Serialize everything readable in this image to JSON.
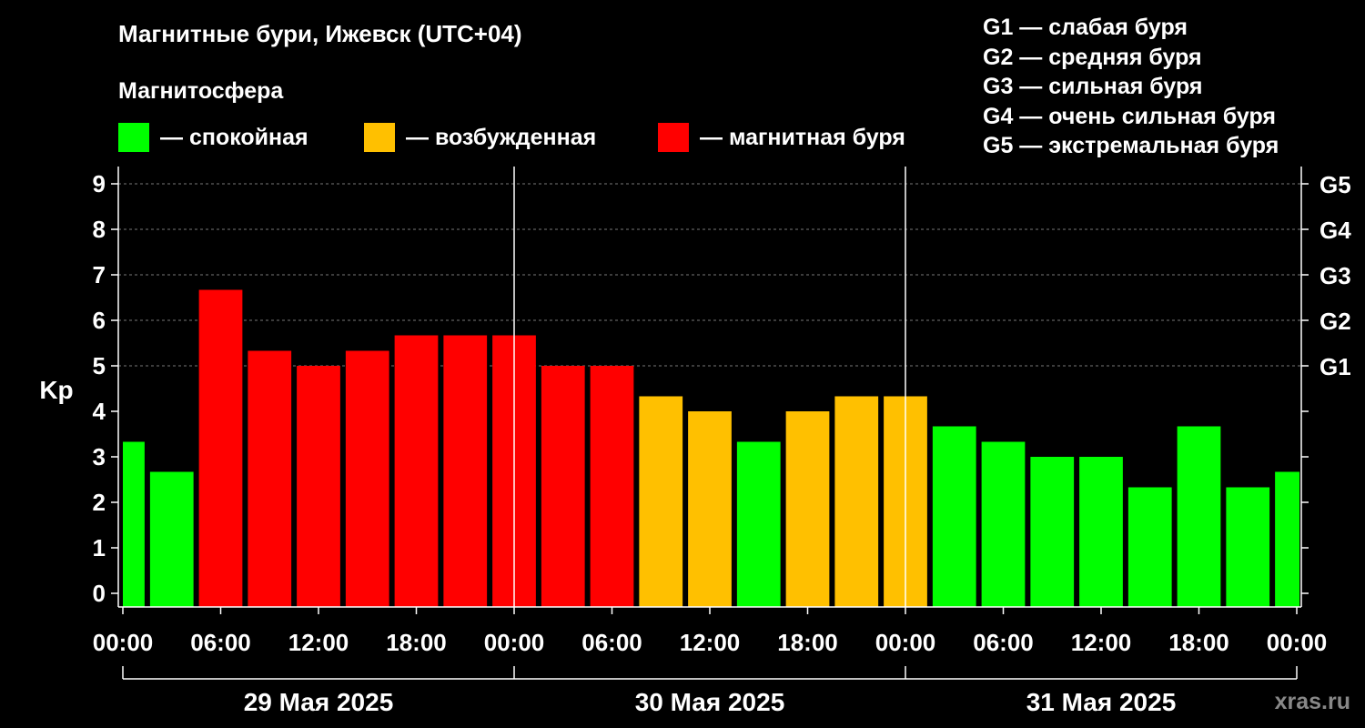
{
  "title": "Магнитные бури, Ижевск (UTC+04)",
  "subtitle": "Магнитосфера",
  "legend": [
    {
      "label": "— спокойная",
      "color": "#00ff00"
    },
    {
      "label": "— возбужденная",
      "color": "#ffc000"
    },
    {
      "label": "— магнитная буря",
      "color": "#ff0000"
    }
  ],
  "g_legend": [
    "G1 — слабая буря",
    "G2 — средняя буря",
    "G3 — сильная буря",
    "G4 — очень сильная буря",
    "G5 — экстремальная буря"
  ],
  "watermark": "xras.ru",
  "chart_data": {
    "type": "bar",
    "ylabel": "Kp",
    "ylim": [
      0,
      9
    ],
    "yticks": [
      "0",
      "1",
      "2",
      "3",
      "4",
      "5",
      "6",
      "7",
      "8",
      "9"
    ],
    "right_ticks": [
      {
        "value": 5,
        "label": "G1"
      },
      {
        "value": 6,
        "label": "G2"
      },
      {
        "value": 7,
        "label": "G3"
      },
      {
        "value": 8,
        "label": "G4"
      },
      {
        "value": 9,
        "label": "G5"
      }
    ],
    "xticks": [
      "00:00",
      "06:00",
      "12:00",
      "18:00",
      "00:00",
      "06:00",
      "12:00",
      "18:00",
      "00:00",
      "06:00",
      "12:00",
      "18:00",
      "00:00"
    ],
    "days": [
      "29 Мая 2025",
      "30 Мая 2025",
      "31 Мая 2025"
    ],
    "grid": "horizontal dashed at 5–9",
    "values": [
      3.33,
      2.67,
      6.67,
      5.33,
      5.0,
      5.33,
      5.67,
      5.67,
      5.67,
      5.0,
      5.0,
      4.33,
      4.0,
      3.33,
      4.0,
      4.33,
      4.33,
      3.67,
      3.33,
      3.0,
      3.0,
      2.33,
      3.67,
      2.33,
      2.67
    ],
    "colors": [
      "#00ff00",
      "#00ff00",
      "#ff0000",
      "#ff0000",
      "#ff0000",
      "#ff0000",
      "#ff0000",
      "#ff0000",
      "#ff0000",
      "#ff0000",
      "#ff0000",
      "#ffc000",
      "#ffc000",
      "#00ff00",
      "#ffc000",
      "#ffc000",
      "#ffc000",
      "#00ff00",
      "#00ff00",
      "#00ff00",
      "#00ff00",
      "#00ff00",
      "#00ff00",
      "#00ff00",
      "#00ff00"
    ]
  }
}
